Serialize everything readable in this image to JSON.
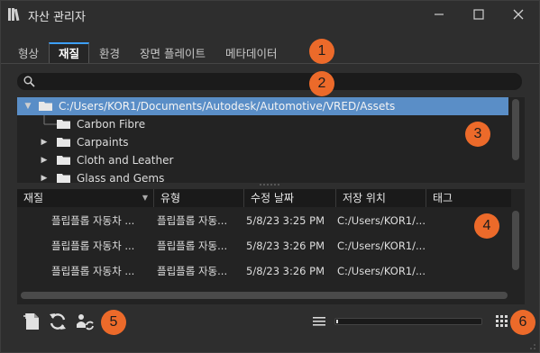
{
  "window": {
    "title": "자산 관리자"
  },
  "tabs": [
    {
      "label": "형상"
    },
    {
      "label": "재질"
    },
    {
      "label": "환경"
    },
    {
      "label": "장면 플레이트"
    },
    {
      "label": "메타데이터"
    }
  ],
  "active_tab": "재질",
  "search": {
    "value": "",
    "placeholder": ""
  },
  "tree": {
    "root": "C:/Users/KOR1/Documents/Autodesk/Automotive/VRED/Assets",
    "items": [
      {
        "label": "Carbon Fibre"
      },
      {
        "label": "Carpaints"
      },
      {
        "label": "Cloth and Leather"
      },
      {
        "label": "Glass and Gems"
      }
    ]
  },
  "table": {
    "columns": [
      "재질",
      "유형",
      "수정 날짜",
      "저장 위치",
      "태그"
    ],
    "rows": [
      [
        "플립플롭 자동차 ...",
        "플립플롭 자동...",
        "5/8/23 3:25 PM",
        "C:/Users/KOR1/..."
      ],
      [
        "플립플롭 자동차 ...",
        "플립플롭 자동...",
        "5/8/23 3:26 PM",
        "C:/Users/KOR1/..."
      ],
      [
        "플립플롭 자동차 ...",
        "플립플롭 자동...",
        "5/8/23 3:26 PM",
        "C:/Users/KOR1/..."
      ]
    ]
  },
  "callouts": [
    "1",
    "2",
    "3",
    "4",
    "5",
    "6"
  ],
  "progress": {
    "fraction": 0.01
  },
  "icons": {
    "app": "books-icon",
    "search": "magnifier-icon",
    "new": "new-file-icon",
    "refresh": "refresh-icon",
    "replace": "replace-icon",
    "list_view": "list-view-icon",
    "grid_view": "grid-view-icon"
  },
  "colors": {
    "accent": "#3da0ff",
    "callout": "#ec6a2a",
    "selection": "#5a8ec7"
  }
}
